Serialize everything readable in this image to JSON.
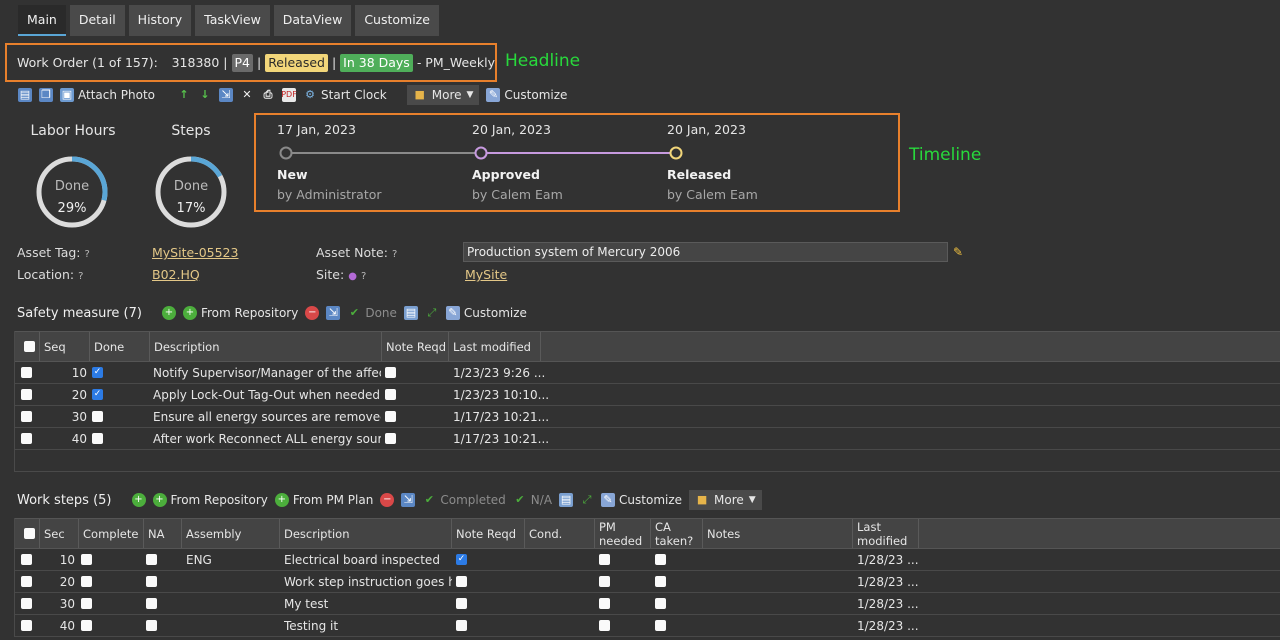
{
  "tabs": [
    "Main",
    "Detail",
    "History",
    "TaskView",
    "DataView",
    "Customize"
  ],
  "headline": {
    "text": "Work Order (1 of 157):",
    "wo_number": "318380",
    "sep": "|",
    "priority": "P4",
    "status": "Released",
    "due": "In 38 Days",
    "suffix": "- PM_Weekly",
    "annotation": "Headline"
  },
  "toolbar": {
    "attach_photo": "Attach Photo",
    "start_clock": "Start Clock",
    "more": "More",
    "customize": "Customize"
  },
  "gauges": [
    {
      "label": "Labor Hours",
      "status": "Done",
      "percent_text": "29%",
      "value": 0.29
    },
    {
      "label": "Steps",
      "status": "Done",
      "percent_text": "17%",
      "value": 0.17
    }
  ],
  "timeline": {
    "annotation": "Timeline",
    "stages": [
      {
        "date": "17 Jan, 2023",
        "stage": "New",
        "by": "by Administrator",
        "color": "#8a8a8a"
      },
      {
        "date": "20 Jan, 2023",
        "stage": "Approved",
        "by": "by Calem Eam",
        "color": "#c79adf"
      },
      {
        "date": "20 Jan, 2023",
        "stage": "Released",
        "by": "by Calem Eam",
        "color": "#f2d67a"
      }
    ]
  },
  "fields": {
    "asset_tag_label": "Asset Tag:",
    "asset_tag_value": "MySite-05523",
    "location_label": "Location:",
    "location_value": "B02.HQ",
    "asset_note_label": "Asset Note:",
    "asset_note_value": "Production system of Mercury 2006",
    "site_label": "Site:",
    "site_value": "MySite",
    "help": "?"
  },
  "safety": {
    "title": "Safety measure (7)",
    "toolbar": {
      "from_repository": "From Repository",
      "done": "Done",
      "customize": "Customize"
    },
    "columns": {
      "seq": "Seq",
      "done": "Done",
      "description": "Description",
      "note_reqd": "Note Reqd",
      "last_modified": "Last modified"
    },
    "rows": [
      {
        "seq": "10",
        "done": true,
        "description": "Notify Supervisor/Manager of the affecte...",
        "note": false,
        "modified": "1/23/23 9:26 ..."
      },
      {
        "seq": "20",
        "done": true,
        "description": "Apply Lock-Out Tag-Out when needed",
        "note": false,
        "modified": "1/23/23 10:10..."
      },
      {
        "seq": "30",
        "done": false,
        "description": "Ensure all energy sources are removed b...",
        "note": false,
        "modified": "1/17/23 10:21..."
      },
      {
        "seq": "40",
        "done": false,
        "description": "After work Reconnect ALL energy sources...",
        "note": false,
        "modified": "1/17/23 10:21..."
      }
    ]
  },
  "worksteps": {
    "title": "Work steps (5)",
    "toolbar": {
      "from_repository": "From Repository",
      "from_pm_plan": "From PM Plan",
      "completed": "Completed",
      "na": "N/A",
      "customize": "Customize",
      "more": "More"
    },
    "columns": {
      "seq": "Sec",
      "complete": "Complete",
      "na": "NA",
      "assembly": "Assembly",
      "description": "Description",
      "note_reqd": "Note Reqd",
      "cond": "Cond.",
      "pm_needed": "PM needed",
      "ca_taken": "CA taken?",
      "notes": "Notes",
      "last_modified": "Last modified"
    },
    "rows": [
      {
        "seq": "10",
        "assembly": "ENG",
        "description": "Electrical board inspected",
        "note": true,
        "modified": "1/28/23 ..."
      },
      {
        "seq": "20",
        "assembly": "",
        "description": "Work step instruction goes here",
        "note": false,
        "modified": "1/28/23 ..."
      },
      {
        "seq": "30",
        "assembly": "",
        "description": "My test",
        "note": false,
        "modified": "1/28/23 ..."
      },
      {
        "seq": "40",
        "assembly": "",
        "description": "Testing it",
        "note": false,
        "modified": "1/28/23 ..."
      }
    ]
  }
}
